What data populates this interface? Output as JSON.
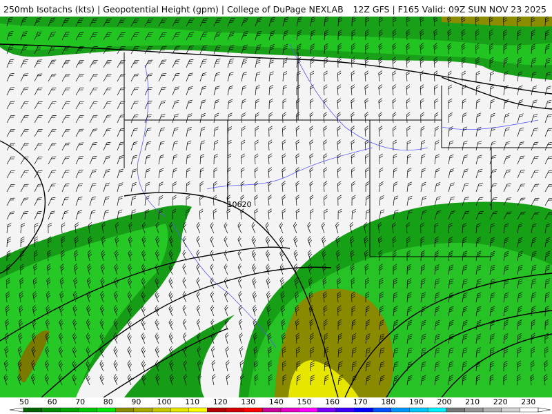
{
  "header": {
    "left": "250mb Isotachs (kts) | Geopotential Height (gpm) | College of DuPage NEXLAB",
    "right": "12Z GFS | F165 Valid: 09Z SUN NOV 23 2025"
  },
  "map": {
    "height_label": "10620"
  },
  "legend": {
    "ticks": [
      "50",
      "60",
      "70",
      "80",
      "90",
      "100",
      "110",
      "120",
      "130",
      "140",
      "150",
      "160",
      "170",
      "180",
      "190",
      "200",
      "210",
      "220",
      "230"
    ],
    "colors": [
      "#006400",
      "#008c00",
      "#00a600",
      "#00c800",
      "#00e600",
      "#8c8c00",
      "#a8a800",
      "#c8c800",
      "#e6e600",
      "#ffff00",
      "#b40000",
      "#d20000",
      "#ff0000",
      "#c8009c",
      "#e600c8",
      "#ff00ff",
      "#7800ff",
      "#3c00ff",
      "#0000ff",
      "#0050ff",
      "#0096ff",
      "#00c8ff",
      "#00f0ff",
      "#787878",
      "#969696",
      "#b4b4b4",
      "#d2d2d2",
      "#ffffff"
    ]
  }
}
